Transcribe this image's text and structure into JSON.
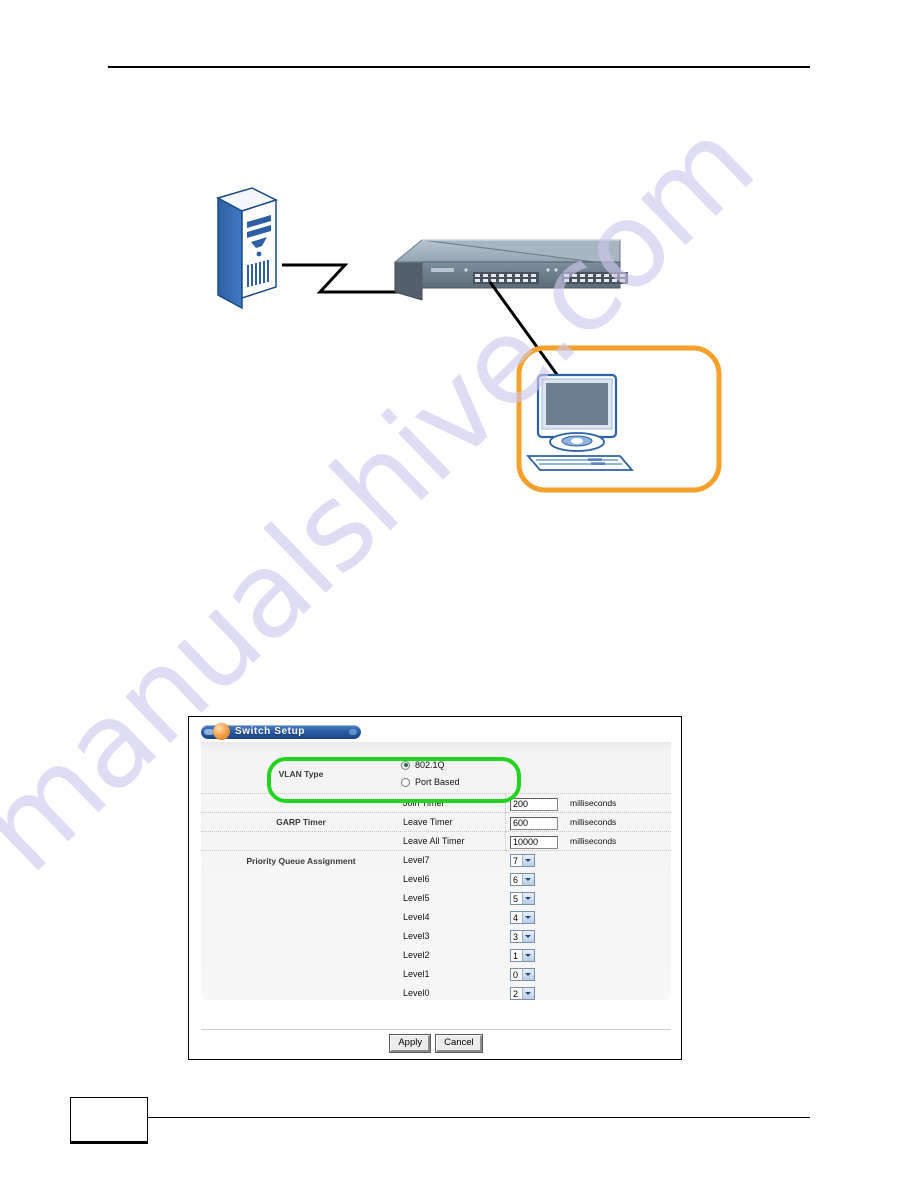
{
  "document": {
    "page_number": "",
    "watermark": "manualshive.com"
  },
  "diagram": {
    "label": "network-topology",
    "nodes": [
      {
        "name": "server",
        "type": "tower-server-icon"
      },
      {
        "name": "switch",
        "type": "ethernet-switch-icon"
      },
      {
        "name": "management-computer",
        "type": "desktop-computer-icon"
      }
    ],
    "highlight_color": "#F5A02A"
  },
  "screenshot": {
    "title": "Switch Setup",
    "highlight_color": "#22D31F",
    "vlan": {
      "label": "VLAN Type",
      "options": [
        {
          "label": "802.1Q",
          "selected": true
        },
        {
          "label": "Port Based",
          "selected": false
        }
      ]
    },
    "garp": {
      "label": "GARP Timer",
      "rows": [
        {
          "label": "Join Timer",
          "value": "200",
          "unit": "milliseconds"
        },
        {
          "label": "Leave Timer",
          "value": "600",
          "unit": "milliseconds"
        },
        {
          "label": "Leave All Timer",
          "value": "10000",
          "unit": "milliseconds"
        }
      ]
    },
    "priority": {
      "label": "Priority Queue Assignment",
      "rows": [
        {
          "label": "Level7",
          "value": "7"
        },
        {
          "label": "Level6",
          "value": "6"
        },
        {
          "label": "Level5",
          "value": "5"
        },
        {
          "label": "Level4",
          "value": "4"
        },
        {
          "label": "Level3",
          "value": "3"
        },
        {
          "label": "Level2",
          "value": "1"
        },
        {
          "label": "Level1",
          "value": "0"
        },
        {
          "label": "Level0",
          "value": "2"
        }
      ]
    },
    "buttons": {
      "apply": "Apply",
      "cancel": "Cancel"
    }
  }
}
